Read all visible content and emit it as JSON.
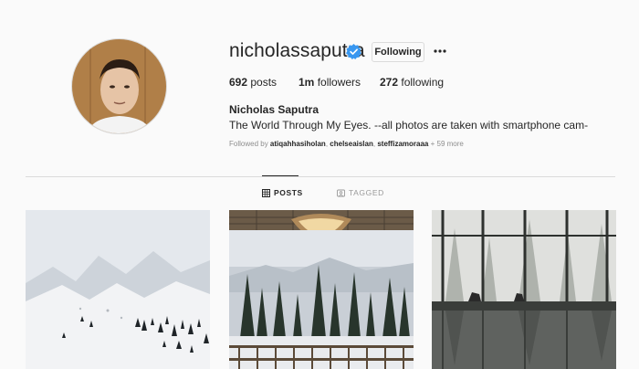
{
  "profile": {
    "username": "nicholassaputra",
    "follow_button": "Following",
    "stats": {
      "posts": "692",
      "posts_label": "posts",
      "followers": "1m",
      "followers_label": "followers",
      "following": "272",
      "following_label": "following"
    },
    "full_name": "Nicholas Saputra",
    "bio": "The World Through My Eyes. --all photos are taken with smartphone cam-",
    "followed_by": {
      "prefix": "Followed by",
      "names": [
        "atiqahhasiholan",
        "chelseaislan",
        "steffizamoraaa"
      ],
      "more": "+ 59 more"
    }
  },
  "tabs": [
    {
      "label": "POSTS",
      "icon": "grid-icon",
      "active": true
    },
    {
      "label": "TAGGED",
      "icon": "tag-icon",
      "active": false
    }
  ],
  "colors": {
    "accent": "#3897f0",
    "text": "#262626",
    "muted": "#8e8e8e",
    "border": "#dbdbdb",
    "background": "#fafafa"
  }
}
